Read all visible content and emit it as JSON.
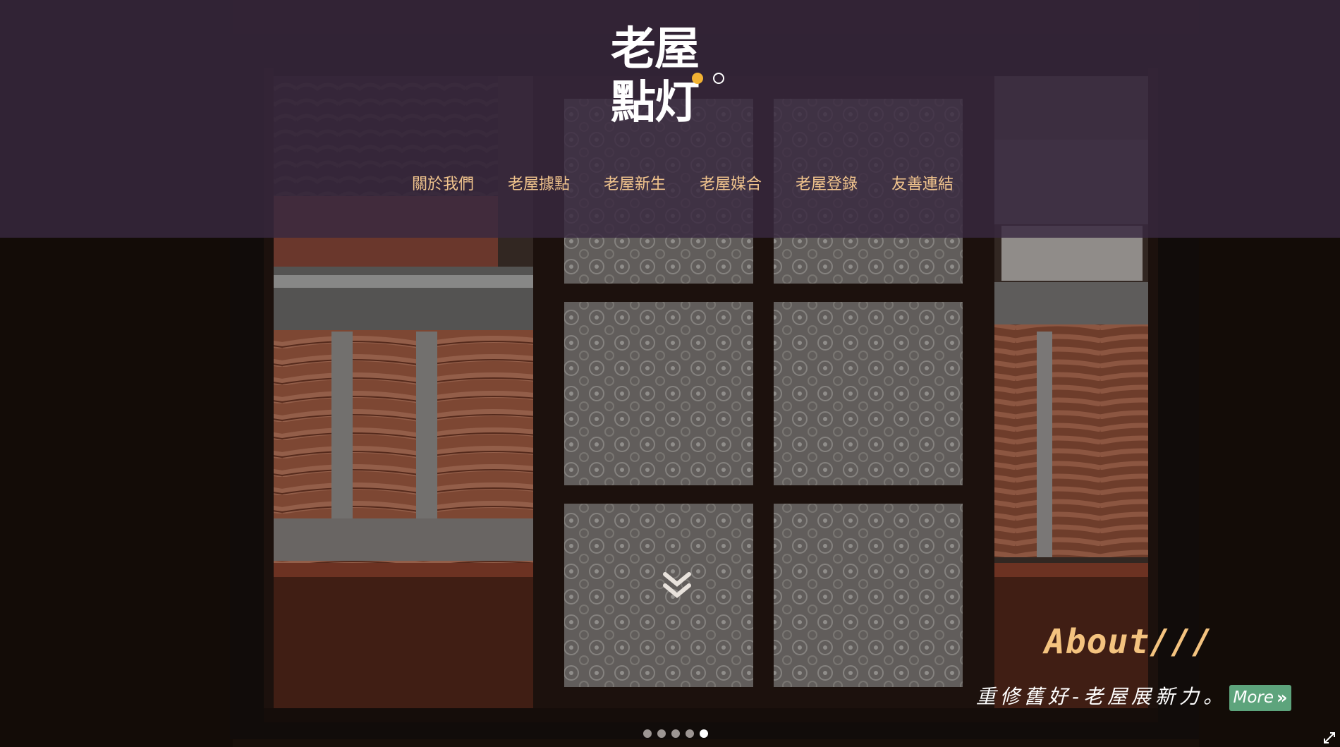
{
  "brand": {
    "logo_line1": "老屋",
    "logo_line2": "點灯"
  },
  "nav": {
    "items": [
      {
        "label": "關於我們"
      },
      {
        "label": "老屋據點"
      },
      {
        "label": "老屋新生"
      },
      {
        "label": "老屋媒合"
      },
      {
        "label": "老屋登錄"
      },
      {
        "label": "友善連結"
      }
    ]
  },
  "hero": {
    "section_title": "About///",
    "tagline": "重修舊好-老屋展新力。",
    "more_label": "More",
    "slides_total": 5,
    "active_slide": 5
  },
  "colors": {
    "header_bg": "#382840",
    "nav_text": "#f1c48d",
    "title_text": "#f4c37f",
    "more_button": "#5da47c",
    "logo_dot": "#f2b233"
  },
  "icons": {
    "scroll": "double-chevron-down-icon",
    "more": "double-chevron-right-icon",
    "expand": "expand-arrows-icon"
  }
}
